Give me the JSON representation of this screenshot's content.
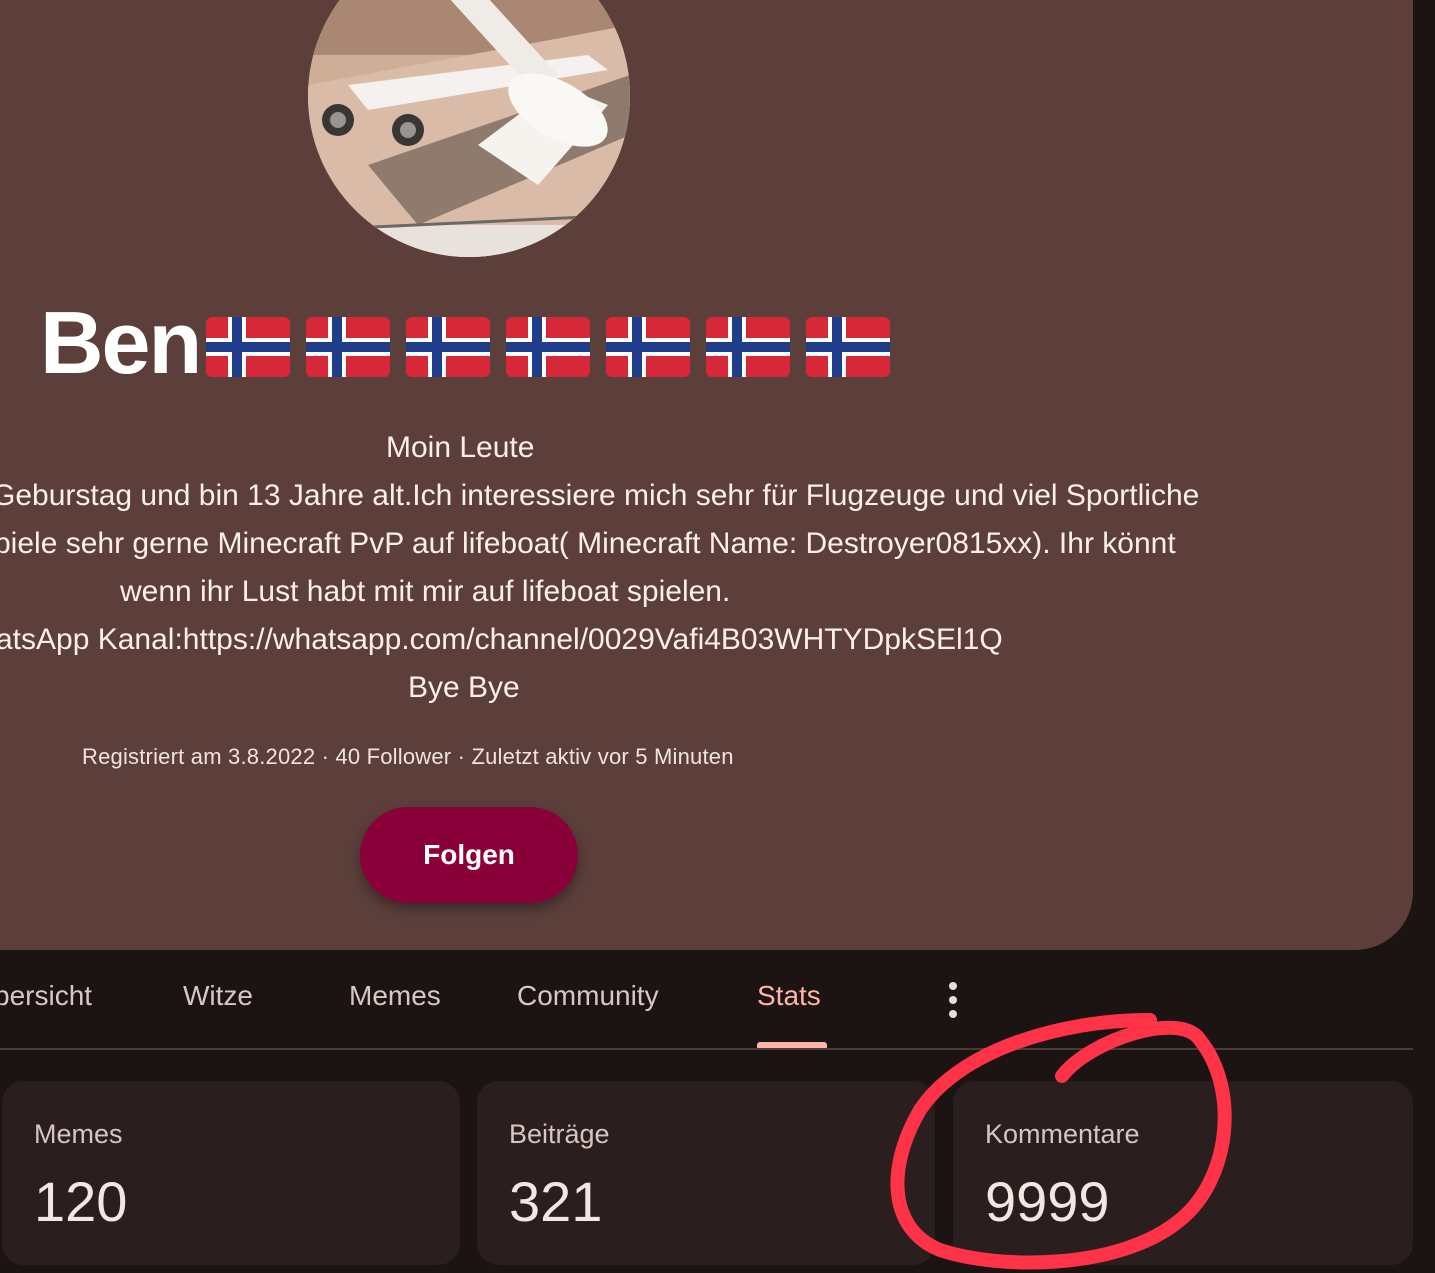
{
  "profile": {
    "name": "Ben",
    "flags": [
      "🇳🇴",
      "🇳🇴",
      "🇳🇴",
      "🇳🇴",
      "🇳🇴",
      "🇳🇴",
      "🇳🇴"
    ],
    "bio": [
      "Moin Leute",
      "Geburstag und bin 13 Jahre alt.Ich interessiere mich sehr für Flugzeuge und viel Sportliche",
      "piele sehr gerne Minecraft PvP auf lifeboat( Minecraft Name: Destroyer0815xx). Ihr könnt",
      "wenn ihr Lust habt mit mir auf lifeboat spielen.",
      "atsApp Kanal:https://whatsapp.com/channel/0029Vafi4B03WHTYDpkSEl1Q",
      "Bye Bye"
    ],
    "meta": "Registriert am 3.8.2022 · 40 Follower · Zuletzt aktiv vor 5 Minuten",
    "follow_label": "Folgen"
  },
  "tabs": [
    {
      "label": "bersicht"
    },
    {
      "label": "Witze"
    },
    {
      "label": "Memes"
    },
    {
      "label": "Community"
    },
    {
      "label": "Stats",
      "active": true
    }
  ],
  "stats": [
    {
      "label": "Memes",
      "value": "120"
    },
    {
      "label": "Beiträge",
      "value": "321"
    },
    {
      "label": "Kommentare",
      "value": "9999"
    }
  ],
  "colors": {
    "card": "#5c3f3b",
    "background": "#1c1313",
    "accent": "#ffb4a8",
    "follow_button": "#8a0039",
    "annotation": "#ff3347"
  }
}
